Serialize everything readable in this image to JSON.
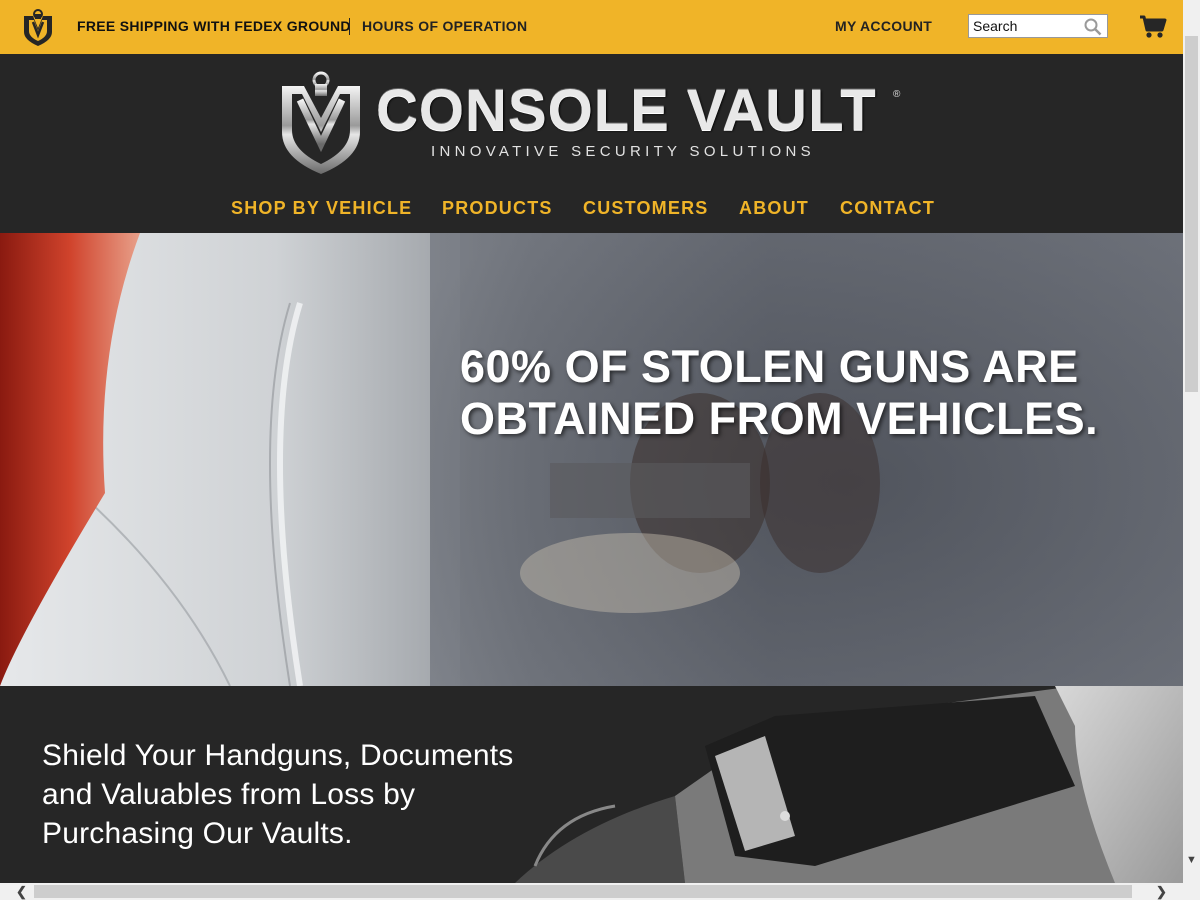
{
  "topbar": {
    "shipping_label": "FREE SHIPPING WITH FEDEX GROUND",
    "hours_label": "HOURS OF OPERATION",
    "account_label": "MY ACCOUNT",
    "search_placeholder": "Search",
    "search_icon": "magnifier-icon",
    "cart_icon": "shopping-cart-icon",
    "background_color": "#f0b428"
  },
  "header": {
    "brand_name": "CONSOLE VAULT",
    "brand_reg": "®",
    "tagline": "INNOVATIVE SECURITY SOLUTIONS",
    "background_color": "#262626",
    "nav_color": "#f0b428",
    "nav": [
      {
        "label": "SHOP BY VEHICLE"
      },
      {
        "label": "PRODUCTS"
      },
      {
        "label": "CUSTOMERS"
      },
      {
        "label": "ABOUT"
      },
      {
        "label": "CONTACT"
      }
    ]
  },
  "hero": {
    "headline_line1": "60% OF STOLEN GUNS ARE",
    "headline_line2": "OBTAINED FROM VEHICLES."
  },
  "promo": {
    "line1": "Shield Your Handguns, Documents",
    "line2": "and Valuables from Loss by",
    "line3": "Purchasing Our Vaults."
  },
  "scrollbars": {
    "vertical_up": "▲",
    "vertical_down": "▼",
    "horizontal_left": "❮",
    "horizontal_right": "❯"
  }
}
